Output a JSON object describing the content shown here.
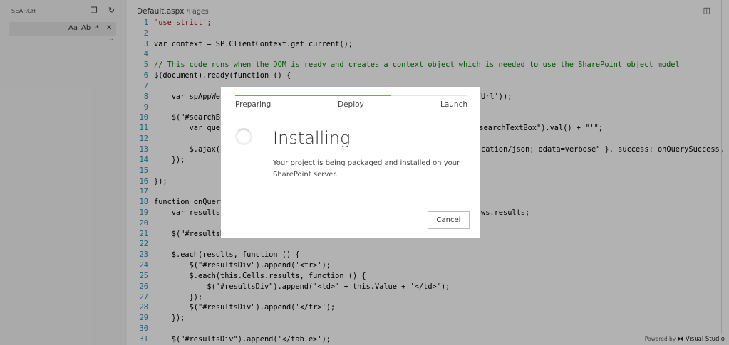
{
  "sidebar": {
    "title": "SEARCH",
    "options": [
      "Aa",
      "Ab",
      "*",
      "✕"
    ],
    "more": "..."
  },
  "editor": {
    "file": "Default.aspx",
    "path": "/Pages"
  },
  "code": [
    {
      "n": "1",
      "t": "'use strict';",
      "c": "str"
    },
    {
      "n": "2",
      "t": ""
    },
    {
      "n": "3",
      "t": "var context = SP.ClientContext.get_current();"
    },
    {
      "n": "4",
      "t": ""
    },
    {
      "n": "5",
      "t": "// This code runs when the DOM is ready and creates a context object which is needed to use the SharePoint object model",
      "c": "cm"
    },
    {
      "n": "6",
      "t": "$(document).ready(function () {"
    },
    {
      "n": "7",
      "t": ""
    },
    {
      "n": "8",
      "t": "    var spAppWe",
      "r": "Url'));"
    },
    {
      "n": "9",
      "t": ""
    },
    {
      "n": "10",
      "t": "    $(\"#searchBu"
    },
    {
      "n": "11",
      "t": "        var que",
      "r": "\"#searchTextBox\").val() + \"'\";"
    },
    {
      "n": "12",
      "t": ""
    },
    {
      "n": "13",
      "t": "        $.ajax(",
      "r": "cation/json; odata=verbose\" }, success: onQuerySuccess,"
    },
    {
      "n": "14",
      "t": "    });"
    },
    {
      "n": "15",
      "t": ""
    },
    {
      "n": "16",
      "t": "});"
    },
    {
      "n": "17",
      "t": ""
    },
    {
      "n": "18",
      "t": "function onQuery"
    },
    {
      "n": "19",
      "t": "    var results",
      "r": "ws.results;"
    },
    {
      "n": "20",
      "t": ""
    },
    {
      "n": "21",
      "t": "    $(\"#resultsD"
    },
    {
      "n": "22",
      "t": ""
    },
    {
      "n": "23",
      "t": "    $.each(results, function () {"
    },
    {
      "n": "24",
      "t": "        $(\"#resultsDiv\").append('<tr>');"
    },
    {
      "n": "25",
      "t": "        $.each(this.Cells.results, function () {"
    },
    {
      "n": "26",
      "t": "            $(\"#resultsDiv\").append('<td>' + this.Value + '</td>');"
    },
    {
      "n": "27",
      "t": "        });"
    },
    {
      "n": "28",
      "t": "        $(\"#resultsDiv\").append('</tr>');"
    },
    {
      "n": "29",
      "t": "    });"
    },
    {
      "n": "30",
      "t": ""
    },
    {
      "n": "31",
      "t": "    $(\"#resultsDiv\").append('</table>');"
    }
  ],
  "dialog": {
    "steps": [
      "Preparing",
      "Deploy",
      "Launch"
    ],
    "progress": 0.67,
    "title": "Installing",
    "message": "Your project is being packaged and installed on your SharePoint server.",
    "cancel": "Cancel"
  },
  "footer": {
    "powered": "Powered by",
    "brand": "Visual Studio"
  },
  "colors": {
    "progress": "#5cb946"
  }
}
